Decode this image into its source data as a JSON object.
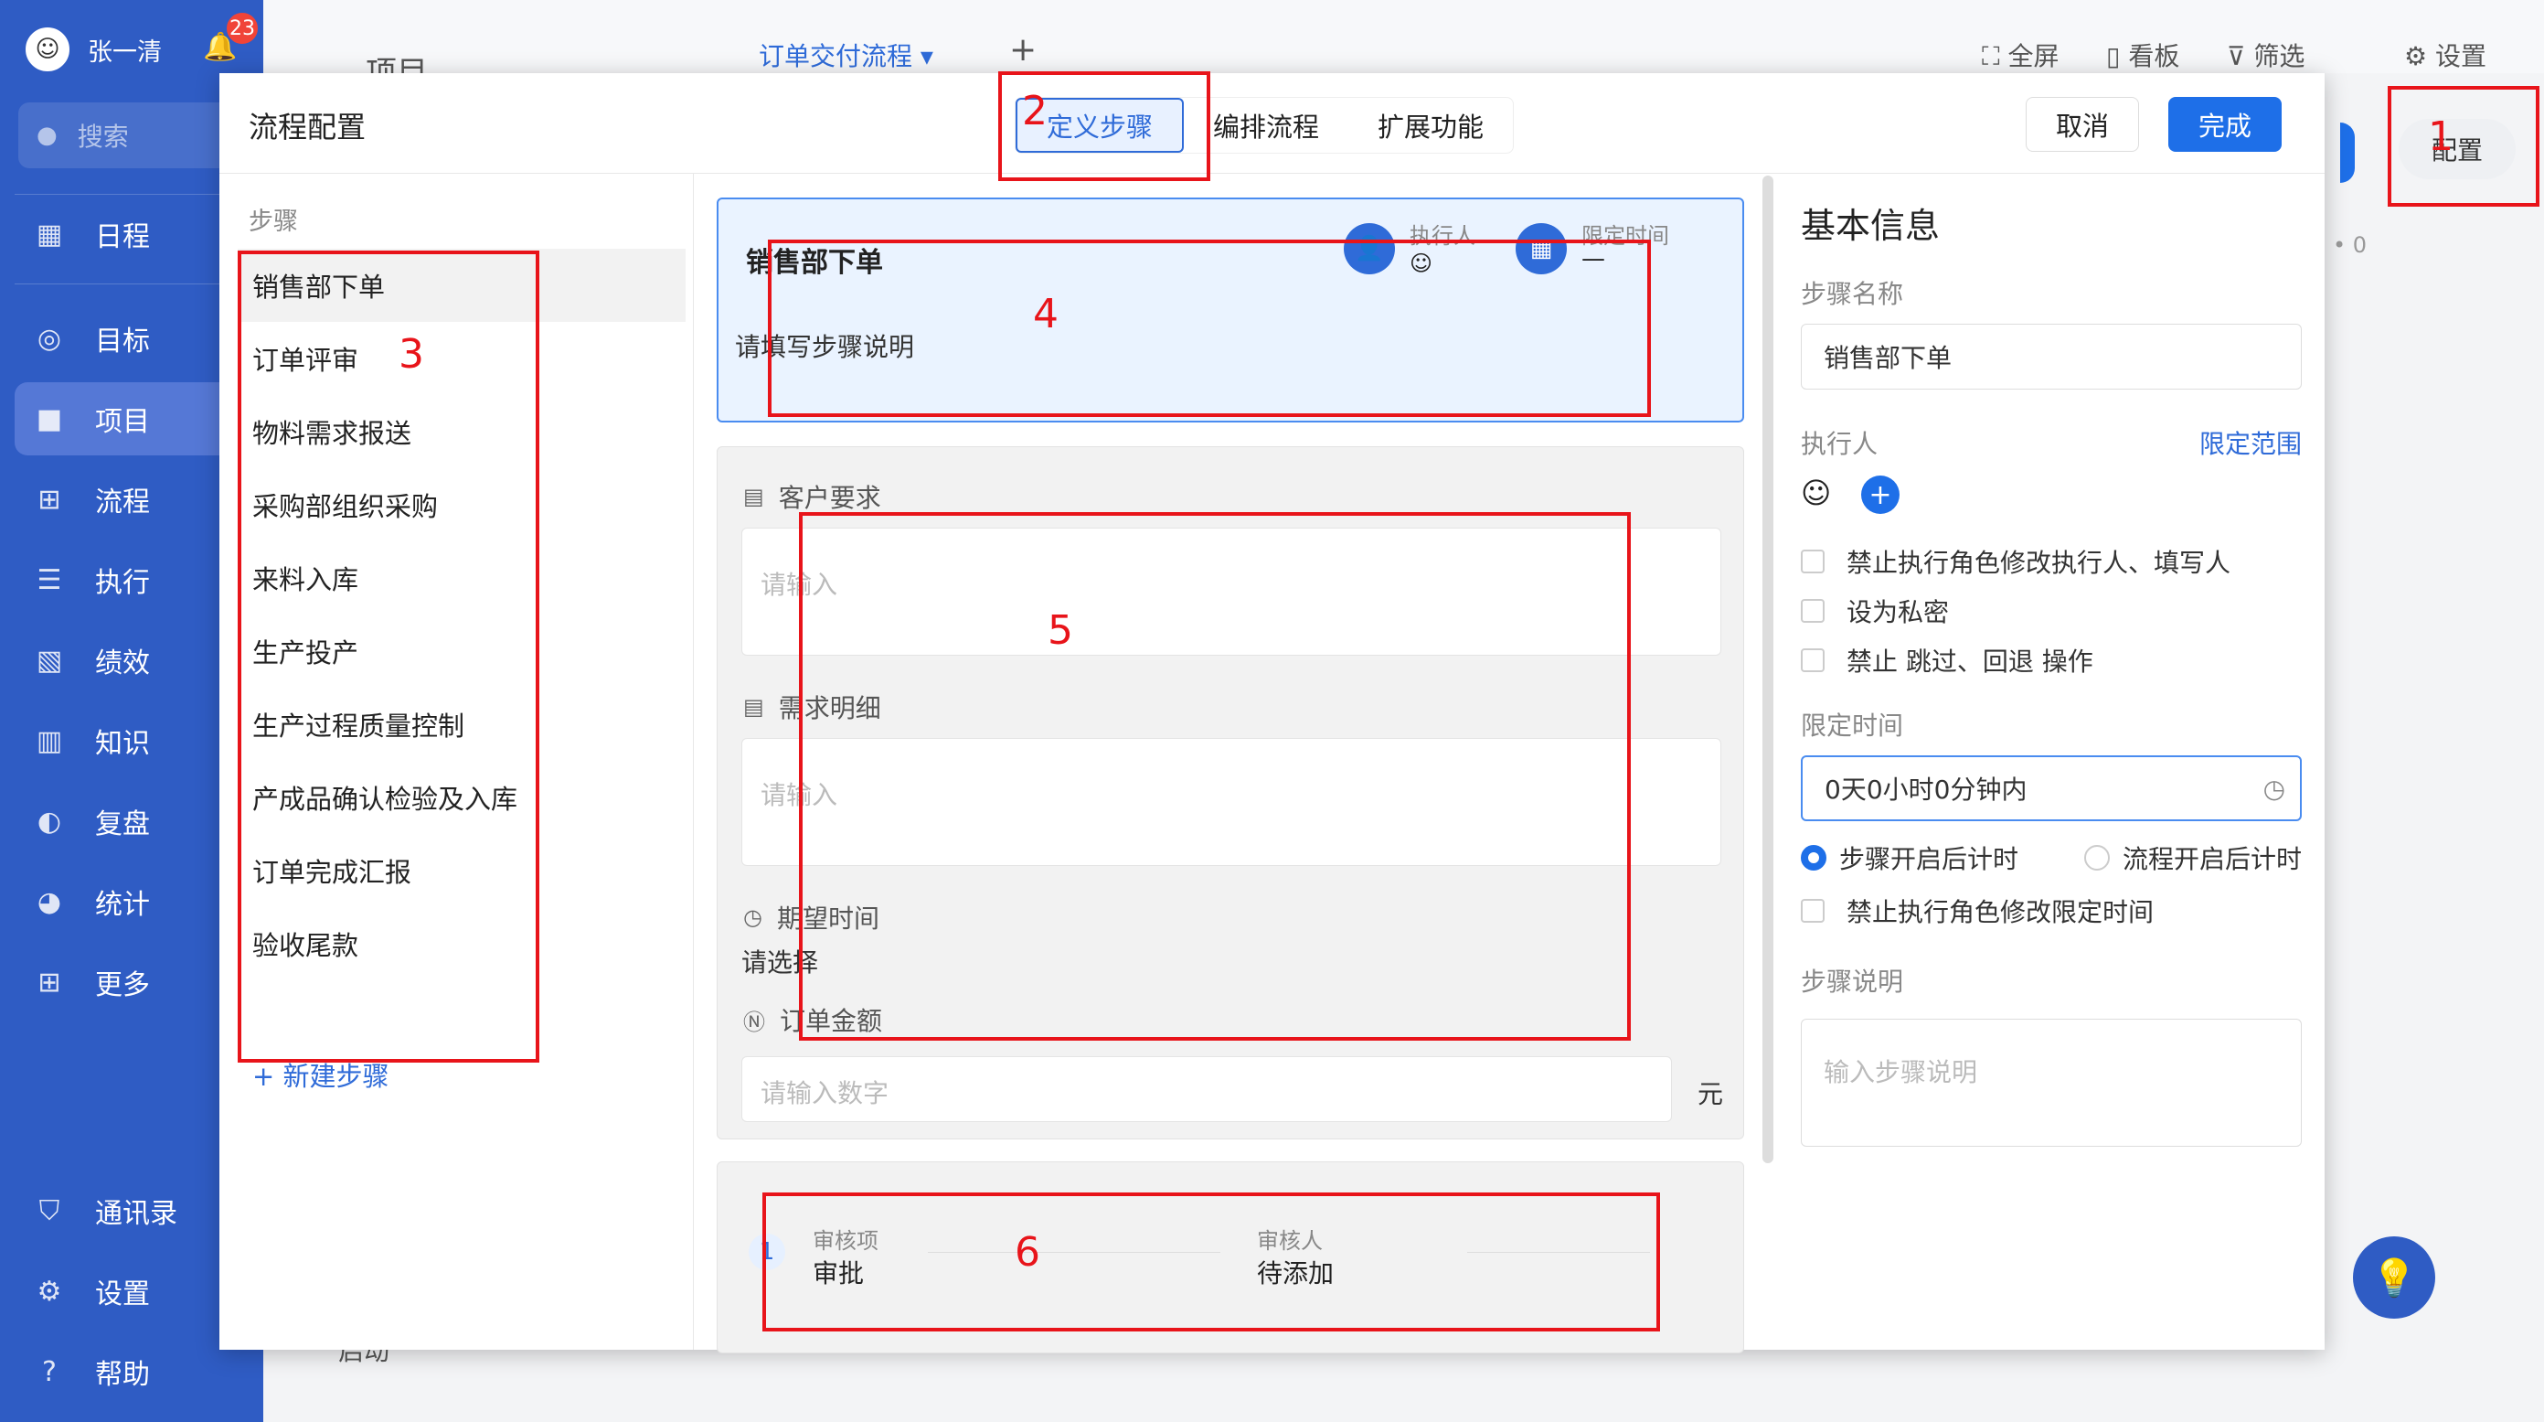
{
  "user": {
    "name": "张一清",
    "notifications": "23"
  },
  "sidebar": {
    "search": "搜索",
    "items": [
      {
        "label": "日程",
        "icon": "calendar-icon"
      },
      {
        "label": "目标",
        "icon": "target-icon"
      },
      {
        "label": "项目",
        "icon": "cube-icon"
      },
      {
        "label": "流程",
        "icon": "flow-icon"
      },
      {
        "label": "执行",
        "icon": "list-icon"
      },
      {
        "label": "绩效",
        "icon": "chart-icon"
      },
      {
        "label": "知识",
        "icon": "book-icon"
      },
      {
        "label": "复盘",
        "icon": "review-icon"
      },
      {
        "label": "统计",
        "icon": "pie-icon"
      },
      {
        "label": "更多",
        "icon": "grid-icon"
      }
    ],
    "bottom": [
      {
        "label": "通讯录",
        "icon": "contacts-icon"
      },
      {
        "label": "设置",
        "icon": "gear-icon"
      },
      {
        "label": "帮助",
        "icon": "help-icon"
      }
    ]
  },
  "background": {
    "page_title": "项目",
    "flow_tab": "订单交付流程",
    "toolbar": {
      "fullscreen": "全屏",
      "board": "看板",
      "filter": "筛选",
      "settings": "设置"
    },
    "config_button": "配置",
    "dot_value": "0",
    "bottom_item": "启动"
  },
  "modal": {
    "title": "流程配置",
    "tabs": [
      "定义步骤",
      "编排流程",
      "扩展功能"
    ],
    "cancel": "取消",
    "done": "完成",
    "steps_label": "步骤",
    "steps": [
      "销售部下单",
      "订单评审",
      "物料需求报送",
      "采购部组织采购",
      "来料入库",
      "生产投产",
      "生产过程质量控制",
      "产成品确认检验及入库",
      "订单完成汇报",
      "验收尾款"
    ],
    "add_step": "+ 新建步骤",
    "step_card": {
      "title": "销售部下单",
      "executor_label": "执行人",
      "time_label": "限定时间",
      "time_value": "—",
      "description": "请填写步骤说明"
    },
    "form": {
      "field1_label": "客户要求",
      "field1_placeholder": "请输入",
      "field2_label": "需求明细",
      "field2_placeholder": "请输入",
      "field3_label": "期望时间",
      "field3_value": "请选择",
      "field4_label": "订单金额",
      "field4_placeholder": "请输入数字",
      "field4_unit": "元"
    },
    "review": {
      "index": "1",
      "item_label": "审核项",
      "item_value": "审批",
      "reviewer_label": "审核人",
      "reviewer_value": "待添加"
    },
    "info": {
      "title": "基本信息",
      "name_label": "步骤名称",
      "name_value": "销售部下单",
      "executor_label": "执行人",
      "scope_link": "限定范围",
      "checks": [
        "禁止执行角色修改执行人、填写人",
        "设为私密",
        "禁止 跳过、回退 操作"
      ],
      "time_label": "限定时间",
      "time_value": "0天0小时0分钟内",
      "radio1": "步骤开启后计时",
      "radio2": "流程开启后计时",
      "time_check": "禁止执行角色修改限定时间",
      "desc_label": "步骤说明",
      "desc_placeholder": "输入步骤说明"
    }
  },
  "annotations": [
    "1",
    "2",
    "3",
    "4",
    "5",
    "6"
  ]
}
